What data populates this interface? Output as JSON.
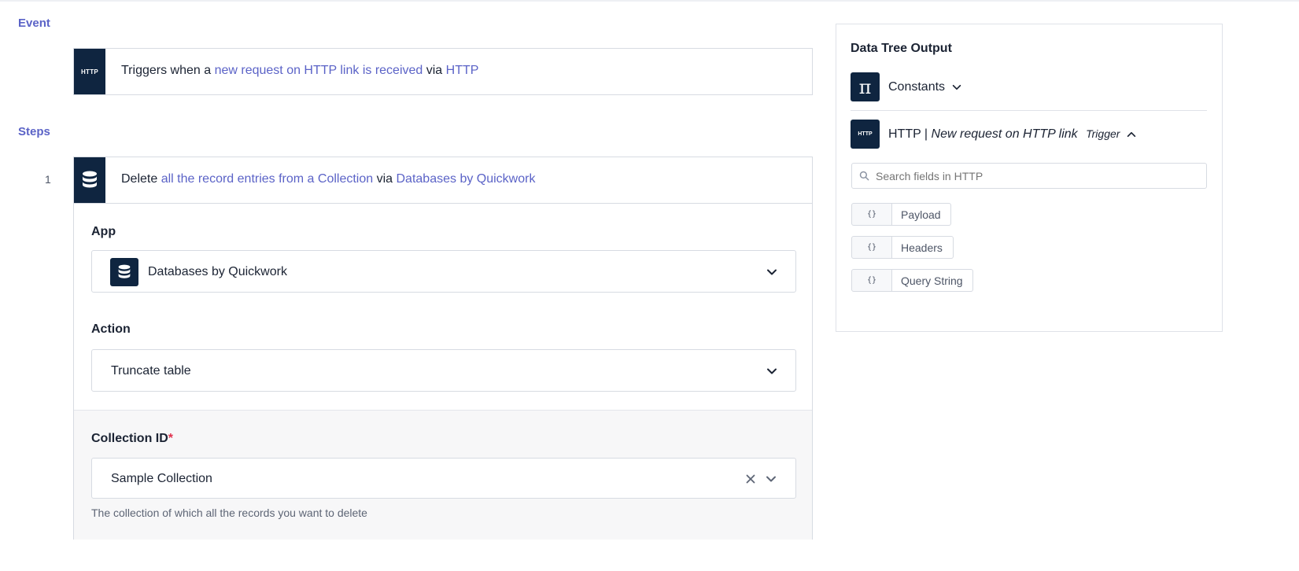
{
  "event": {
    "section_label": "Event",
    "icon_text": "HTTP",
    "sentence": {
      "prefix": "Triggers when a ",
      "link1": "new request on HTTP link is received",
      "mid": " via ",
      "link2": "HTTP"
    }
  },
  "steps": {
    "section_label": "Steps",
    "step_number": "1",
    "sentence": {
      "prefix": "Delete ",
      "link1": "all the record entries from a Collection",
      "mid": " via ",
      "link2": "Databases by Quickwork"
    },
    "app": {
      "label": "App",
      "value": "Databases by Quickwork"
    },
    "action": {
      "label": "Action",
      "value": "Truncate table"
    },
    "collection": {
      "label": "Collection ID",
      "required_marker": "*",
      "value": "Sample Collection",
      "help_text": "The collection of which all the records you want to delete"
    }
  },
  "data_tree": {
    "title": "Data Tree Output",
    "constants": {
      "label": "Constants",
      "icon_text": "π"
    },
    "http": {
      "icon_text": "HTTP",
      "app": "HTTP",
      "separator": " | ",
      "trigger_name": "New request on HTTP link",
      "badge": "Trigger"
    },
    "search_placeholder": "Search fields in HTTP",
    "fields": [
      {
        "icon": "{}",
        "label": "Payload"
      },
      {
        "icon": "{}",
        "label": "Headers"
      },
      {
        "icon": "{}",
        "label": "Query String"
      }
    ]
  },
  "colors": {
    "accent": "#5b63c7",
    "icon_bg": "#0f2540",
    "required": "#e0334e"
  }
}
